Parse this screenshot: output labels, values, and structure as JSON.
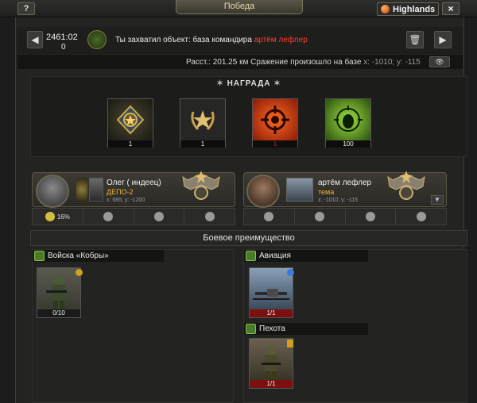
{
  "window": {
    "title": "Победа",
    "help_label": "?",
    "server_label": "Highlands",
    "close_label": "×"
  },
  "header": {
    "time_text": "2461:02",
    "count_text": "0",
    "message_prefix": "Ты захватил объект: база командира",
    "message_target": "артём лефлер",
    "distance_text": "Расст.: 201.25 км  Сражение произошло на базе",
    "distance_coords": "x: -1010; y: -115"
  },
  "rewards": {
    "title": "НАГРАДА",
    "items": [
      {
        "icon": "rank-medal-icon",
        "count": "1"
      },
      {
        "icon": "laurel-star-icon",
        "count": "1"
      },
      {
        "icon": "target-crosshair-icon",
        "count": "1"
      },
      {
        "icon": "mask-crosshair-icon",
        "count": "100"
      }
    ]
  },
  "attacker": {
    "name": "Олег ( индеец)",
    "base": "ДЕПО-2",
    "coords": "x: 685; y: -1200",
    "stat_percent": "16%"
  },
  "defender": {
    "name": "артём лефлер",
    "base": "тема",
    "coords": "x: -1010; y: -115"
  },
  "advantage": {
    "title": "Боевое преимущество",
    "left_group": {
      "label": "Войска «Кобры»",
      "units": [
        {
          "icon": "soldier-icon",
          "count": "0/10"
        }
      ]
    },
    "right_groups": [
      {
        "label": "Авиация",
        "units": [
          {
            "icon": "drone-icon",
            "count": "1/1"
          }
        ]
      },
      {
        "label": "Пехота",
        "units": [
          {
            "icon": "soldier-icon",
            "count": "1/1"
          }
        ]
      }
    ]
  },
  "colors": {
    "accent_red": "#ff3b2f",
    "base_gold": "#e8b23a",
    "count_red_bg": "#7a1010"
  }
}
